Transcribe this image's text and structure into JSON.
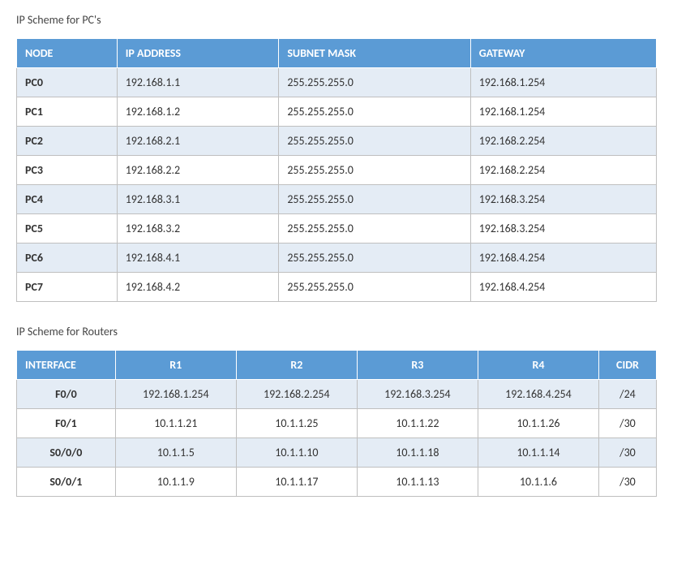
{
  "section1": {
    "title": "IP Scheme for PC's",
    "headers": [
      "NODE",
      "IP ADDRESS",
      "SUBNET MASK",
      "GATEWAY"
    ],
    "rows": [
      {
        "node": "PC0",
        "ip": "192.168.1.1",
        "mask": "255.255.255.0",
        "gateway": "192.168.1.254"
      },
      {
        "node": "PC1",
        "ip": "192.168.1.2",
        "mask": "255.255.255.0",
        "gateway": "192.168.1.254"
      },
      {
        "node": "PC2",
        "ip": "192.168.2.1",
        "mask": "255.255.255.0",
        "gateway": "192.168.2.254"
      },
      {
        "node": "PC3",
        "ip": "192.168.2.2",
        "mask": "255.255.255.0",
        "gateway": "192.168.2.254"
      },
      {
        "node": "PC4",
        "ip": "192.168.3.1",
        "mask": "255.255.255.0",
        "gateway": "192.168.3.254"
      },
      {
        "node": "PC5",
        "ip": "192.168.3.2",
        "mask": "255.255.255.0",
        "gateway": "192.168.3.254"
      },
      {
        "node": "PC6",
        "ip": "192.168.4.1",
        "mask": "255.255.255.0",
        "gateway": "192.168.4.254"
      },
      {
        "node": "PC7",
        "ip": "192.168.4.2",
        "mask": "255.255.255.0",
        "gateway": "192.168.4.254"
      }
    ]
  },
  "section2": {
    "title": "IP Scheme for Routers",
    "headers": [
      "INTERFACE",
      "R1",
      "R2",
      "R3",
      "R4",
      "CIDR"
    ],
    "rows": [
      {
        "iface": "F0/0",
        "r1": "192.168.1.254",
        "r2": "192.168.2.254",
        "r3": "192.168.3.254",
        "r4": "192.168.4.254",
        "cidr": "/24"
      },
      {
        "iface": "F0/1",
        "r1": "10.1.1.21",
        "r2": "10.1.1.25",
        "r3": "10.1.1.22",
        "r4": "10.1.1.26",
        "cidr": "/30"
      },
      {
        "iface": "S0/0/0",
        "r1": "10.1.1.5",
        "r2": "10.1.1.10",
        "r3": "10.1.1.18",
        "r4": "10.1.1.14",
        "cidr": "/30"
      },
      {
        "iface": "S0/0/1",
        "r1": "10.1.1.9",
        "r2": "10.1.1.17",
        "r3": "10.1.1.13",
        "r4": "10.1.1.6",
        "cidr": "/30"
      }
    ]
  }
}
